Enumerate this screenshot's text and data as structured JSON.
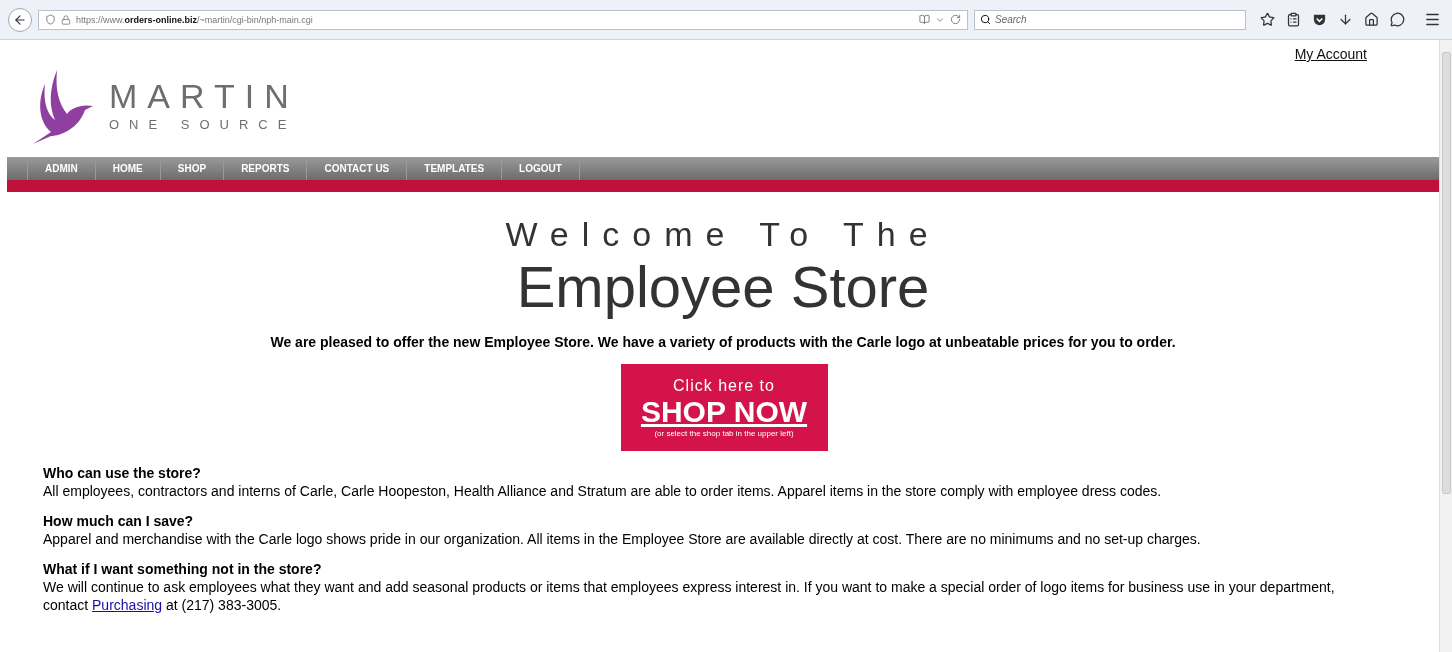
{
  "browser": {
    "url": "https://www.**orders-online.biz**/~martin/cgi-bin/nph-main.cgi",
    "search_placeholder": "Search"
  },
  "header": {
    "account_link": "My Account",
    "logo": {
      "name": "MARTIN",
      "tagline": "ONE SOURCE"
    }
  },
  "nav": [
    {
      "label": "ADMIN"
    },
    {
      "label": "HOME"
    },
    {
      "label": "SHOP"
    },
    {
      "label": "REPORTS"
    },
    {
      "label": "CONTACT US"
    },
    {
      "label": "TEMPLATES"
    },
    {
      "label": "LOGOUT"
    }
  ],
  "hero": {
    "line_1": "Welcome To The",
    "line_2": "Employee Store"
  },
  "intro": "We are pleased to offer the new Employee Store. We have a variety of products with the Carle logo at unbeatable prices for you to order.",
  "shop_banner": {
    "top": "Click here to",
    "main": "SHOP NOW",
    "note": "(or select the shop tab in the upper left)"
  },
  "faq": [
    {
      "question": "Who can use the store?",
      "answer": "All employees, contractors and interns of Carle, Carle Hoopeston, Health Alliance and Stratum are able to order items. Apparel items in the store comply with employee dress codes."
    },
    {
      "question": "How much can I save?",
      "answer": "Apparel and merchandise with the Carle logo shows pride in our organization. All items in the Employee Store are available directly at cost. There are no minimums and no set-up charges."
    },
    {
      "question": "What if I want something not in the store?",
      "answer": "We will continue to ask employees what they want and add seasonal products or items that employees express interest in. If you want to make a special order of logo items for business use in your department, contact",
      "link": "Purchasing",
      "answer_end": "at (217) 383-3005."
    }
  ]
}
